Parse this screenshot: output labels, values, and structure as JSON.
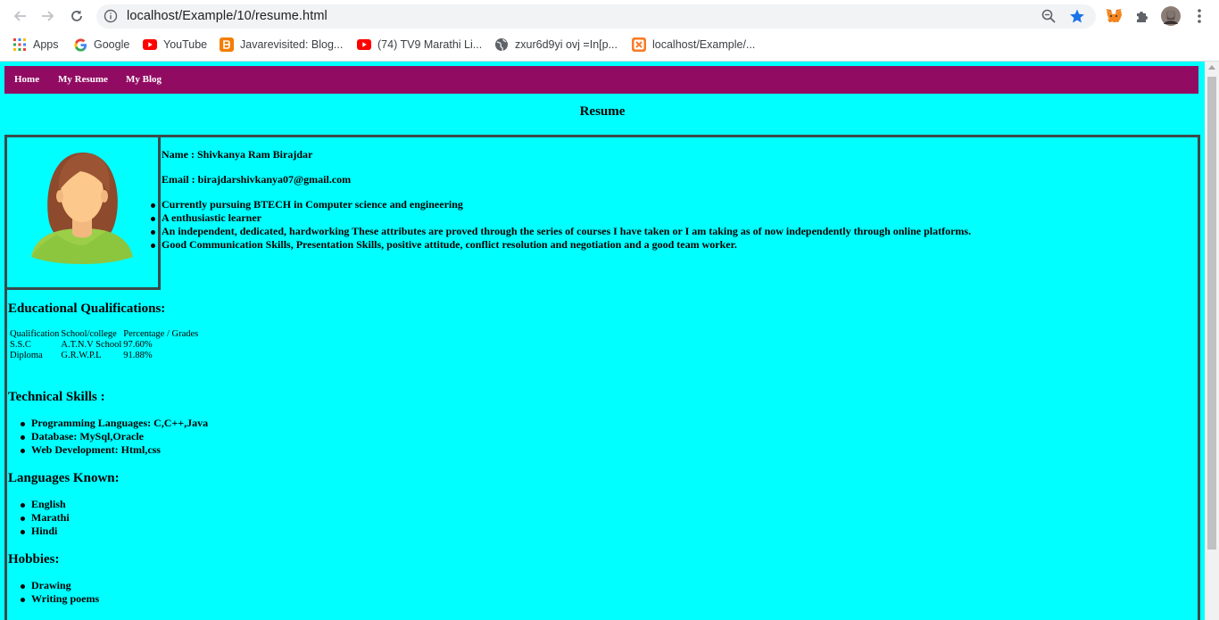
{
  "browser": {
    "url": "localhost/Example/10/resume.html",
    "bookmarks": [
      {
        "label": "Apps",
        "icon": "apps-grid-icon"
      },
      {
        "label": "Google",
        "icon": "google-icon"
      },
      {
        "label": "YouTube",
        "icon": "youtube-icon"
      },
      {
        "label": "Javarevisited: Blog...",
        "icon": "blogger-icon"
      },
      {
        "label": "(74) TV9 Marathi Li...",
        "icon": "youtube-icon"
      },
      {
        "label": "zxur6d9yi ovj =In[p...",
        "icon": "globe-icon"
      },
      {
        "label": "localhost/Example/...",
        "icon": "xampp-icon"
      }
    ]
  },
  "nav": {
    "items": [
      {
        "label": "Home"
      },
      {
        "label": "My Resume"
      },
      {
        "label": "My Blog"
      }
    ]
  },
  "page": {
    "title": "Resume"
  },
  "profile": {
    "name_line": "Name : Shivkanya Ram Birajdar",
    "email_line": "Email : birajdarshivkanya07@gmail.com",
    "highlights": [
      "Currently pursuing BTECH in Computer science and engineering",
      "A enthusiastic learner",
      "An independent, dedicated, hardworking These attributes are proved through the series of courses I have taken or I am taking as of now independently through online platforms.",
      "Good Communication Skills, Presentation Skills, positive attitude, conflict resolution and negotiation and a good team worker."
    ]
  },
  "education": {
    "heading": "Educational Qualifications:",
    "columns": [
      "Qualification",
      "School/college",
      "Percentage / Grades"
    ],
    "rows": [
      [
        "S.S.C",
        "A.T.N.V School",
        "97.60%"
      ],
      [
        "Diploma",
        "G.R.W.P.L",
        "91.88%"
      ]
    ]
  },
  "skills": {
    "heading": "Technical Skills :",
    "items": [
      "Programming Languages: C,C++,Java",
      "Database: MySql,Oracle",
      "Web Development: Html,css"
    ]
  },
  "languages": {
    "heading": "Languages Known:",
    "items": [
      "English",
      "Marathi",
      "Hindi"
    ]
  },
  "hobbies": {
    "heading": "Hobbies:",
    "items": [
      "Drawing",
      "Writing poems"
    ]
  },
  "colors": {
    "page_bg": "#00ffff",
    "nav_bg": "#910b62",
    "border": "#3b4a4a"
  }
}
